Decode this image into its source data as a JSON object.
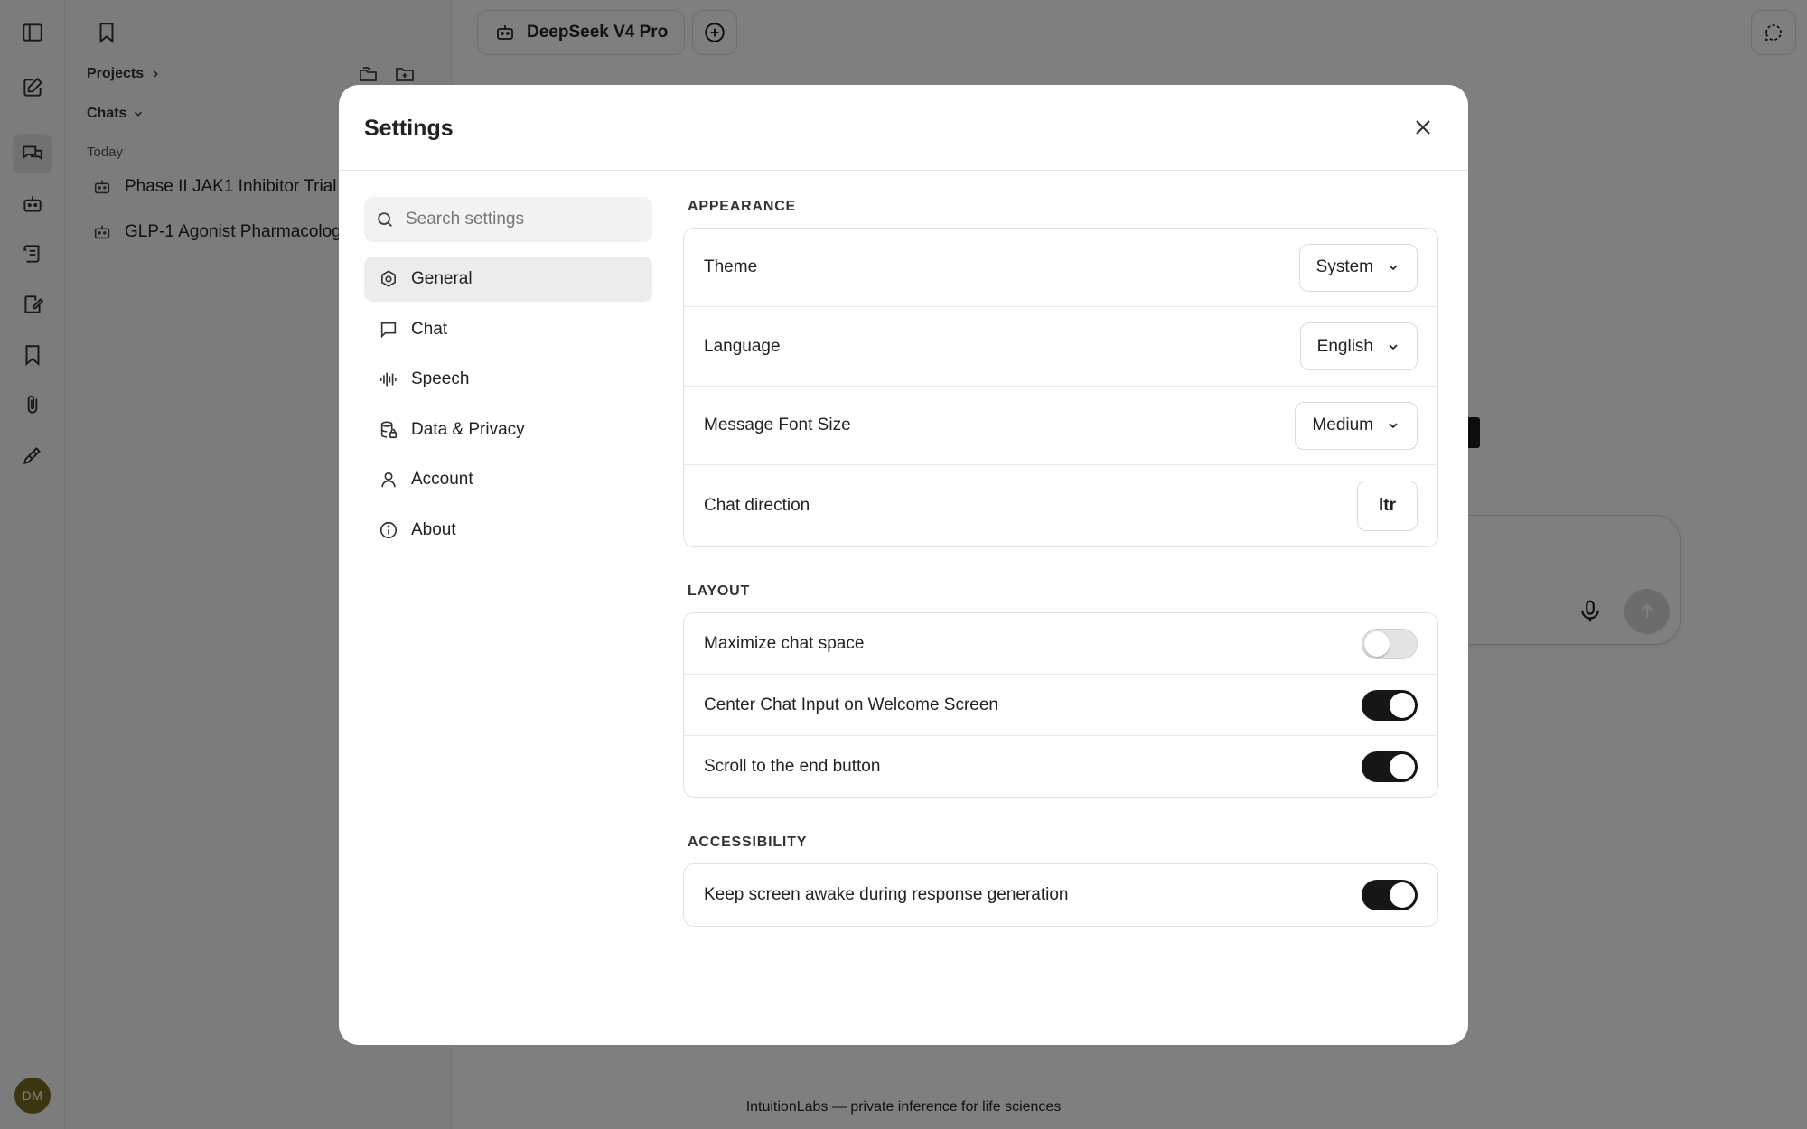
{
  "sidebar": {
    "projects_label": "Projects",
    "chats_label": "Chats",
    "today_label": "Today",
    "chats": [
      {
        "title": "Phase II JAK1 Inhibitor Trial"
      },
      {
        "title": "GLP-1 Agonist Pharmacolog"
      }
    ],
    "avatar_initials": "DM"
  },
  "header": {
    "model_name": "DeepSeek V4 Pro"
  },
  "footer": {
    "note": "IntuitionLabs — private inference for life sciences"
  },
  "settings": {
    "title": "Settings",
    "search_placeholder": "Search settings",
    "nav": [
      {
        "label": "General",
        "icon": "gear-icon",
        "active": true
      },
      {
        "label": "Chat",
        "icon": "chat-bubble-icon"
      },
      {
        "label": "Speech",
        "icon": "waveform-icon"
      },
      {
        "label": "Data & Privacy",
        "icon": "database-lock-icon"
      },
      {
        "label": "Account",
        "icon": "user-icon"
      },
      {
        "label": "About",
        "icon": "info-icon"
      }
    ],
    "appearance": {
      "label": "APPEARANCE",
      "theme_label": "Theme",
      "theme_value": "System",
      "language_label": "Language",
      "language_value": "English",
      "font_size_label": "Message Font Size",
      "font_size_value": "Medium",
      "direction_label": "Chat direction",
      "direction_value": "ltr"
    },
    "layout": {
      "label": "LAYOUT",
      "items": [
        {
          "label": "Maximize chat space",
          "on": false
        },
        {
          "label": "Center Chat Input on Welcome Screen",
          "on": true
        },
        {
          "label": "Scroll to the end button",
          "on": true
        }
      ]
    },
    "accessibility": {
      "label": "ACCESSIBILITY",
      "items": [
        {
          "label": "Keep screen awake during response generation",
          "on": true
        }
      ]
    }
  },
  "colors": {
    "toggle_on": "#161616",
    "toggle_off": "#e3e3e3",
    "avatar": "#7a6a23"
  }
}
